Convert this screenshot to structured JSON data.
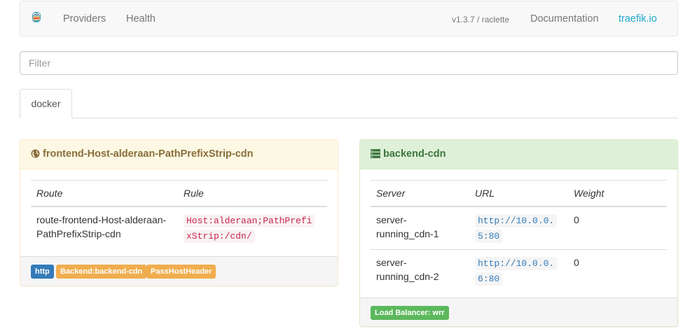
{
  "navbar": {
    "logo_icon": "traefik-gopher-logo-icon",
    "links": [
      "Providers",
      "Health"
    ],
    "version": "v1.3.7 / raclette",
    "documentation": "Documentation",
    "site": "traefik.io",
    "site_color": "#1ea8cc"
  },
  "filter": {
    "placeholder": "Filter",
    "value": ""
  },
  "tabs": [
    {
      "label": "docker",
      "active": true
    }
  ],
  "frontend": {
    "icon": "globe-icon",
    "title": "frontend-Host-alderaan-PathPrefixStrip-cdn",
    "columns": [
      "Route",
      "Rule"
    ],
    "rows": [
      {
        "route": "route-frontend-Host-alderaan-PathPrefixStrip-cdn",
        "rule_lines": [
          "Host:alderaan;PathPrefi",
          "xStrip:/cdn/"
        ]
      }
    ],
    "labels": [
      "http",
      "Backend:backend-cdn",
      "PassHostHeader"
    ],
    "colors": {
      "heading_bg": "#fcf8e3",
      "heading_text": "#8a6d3b",
      "http": "#337ab7",
      "warning": "#f0ad4e"
    }
  },
  "backend": {
    "icon": "server-icon",
    "title": "backend-cdn",
    "columns": [
      "Server",
      "URL",
      "Weight"
    ],
    "rows": [
      {
        "server_lines": [
          "server-",
          "running_cdn-1"
        ],
        "url_lines": [
          "http://10.0.0.",
          "5:80"
        ],
        "weight": "0"
      },
      {
        "server_lines": [
          "server-",
          "running_cdn-2"
        ],
        "url_lines": [
          "http://10.0.0.",
          "6:80"
        ],
        "weight": "0"
      }
    ],
    "load_balancer": "Load Balancer: wrr",
    "colors": {
      "heading_bg": "#dff0d8",
      "heading_text": "#3c763d",
      "success": "#5cb85c"
    }
  }
}
